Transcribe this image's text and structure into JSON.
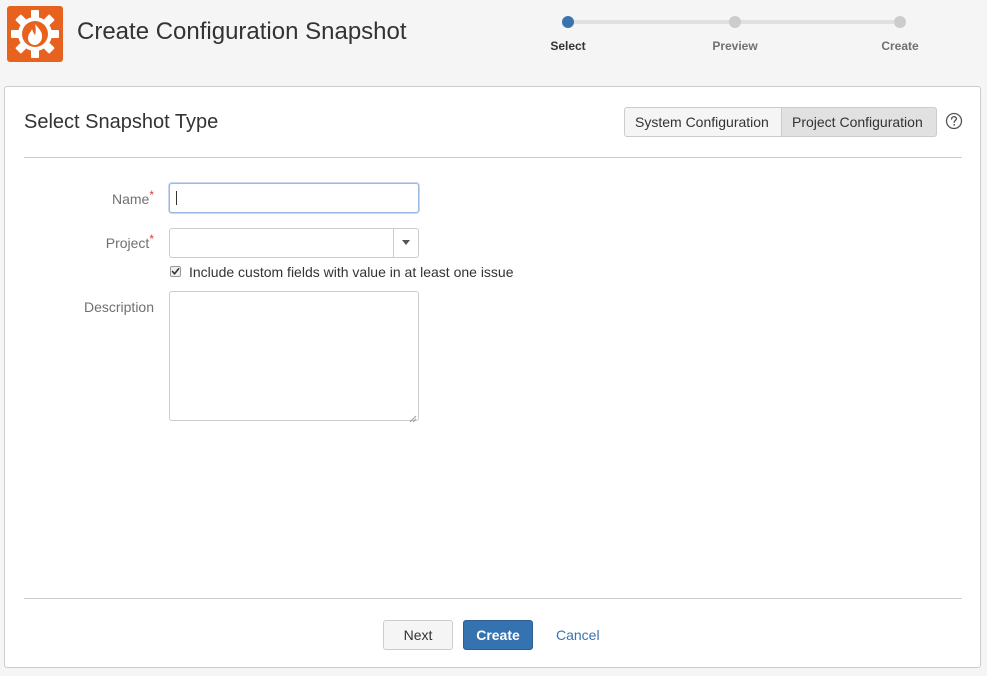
{
  "header": {
    "title": "Create Configuration Snapshot",
    "logo_icon": "gear-flame-icon",
    "brand_color": "#e8621f"
  },
  "stepper": {
    "active_color": "#3b73af",
    "steps": [
      {
        "label": "Select",
        "active": true
      },
      {
        "label": "Preview",
        "active": false
      },
      {
        "label": "Create",
        "active": false
      }
    ]
  },
  "panel": {
    "section_title": "Select Snapshot Type",
    "type_toggle": {
      "options": [
        "System Configuration",
        "Project Configuration"
      ],
      "selected": "Project Configuration"
    },
    "help_icon": "question-circle-icon"
  },
  "form": {
    "name": {
      "label": "Name",
      "required_marker": "*",
      "value": ""
    },
    "project": {
      "label": "Project",
      "required_marker": "*",
      "value": ""
    },
    "include_custom_fields": {
      "label": "Include custom fields with value in at least one issue",
      "checked": true
    },
    "description": {
      "label": "Description",
      "value": ""
    }
  },
  "actions": {
    "next_label": "Next",
    "create_label": "Create",
    "cancel_label": "Cancel",
    "primary_color": "#3572b0"
  }
}
